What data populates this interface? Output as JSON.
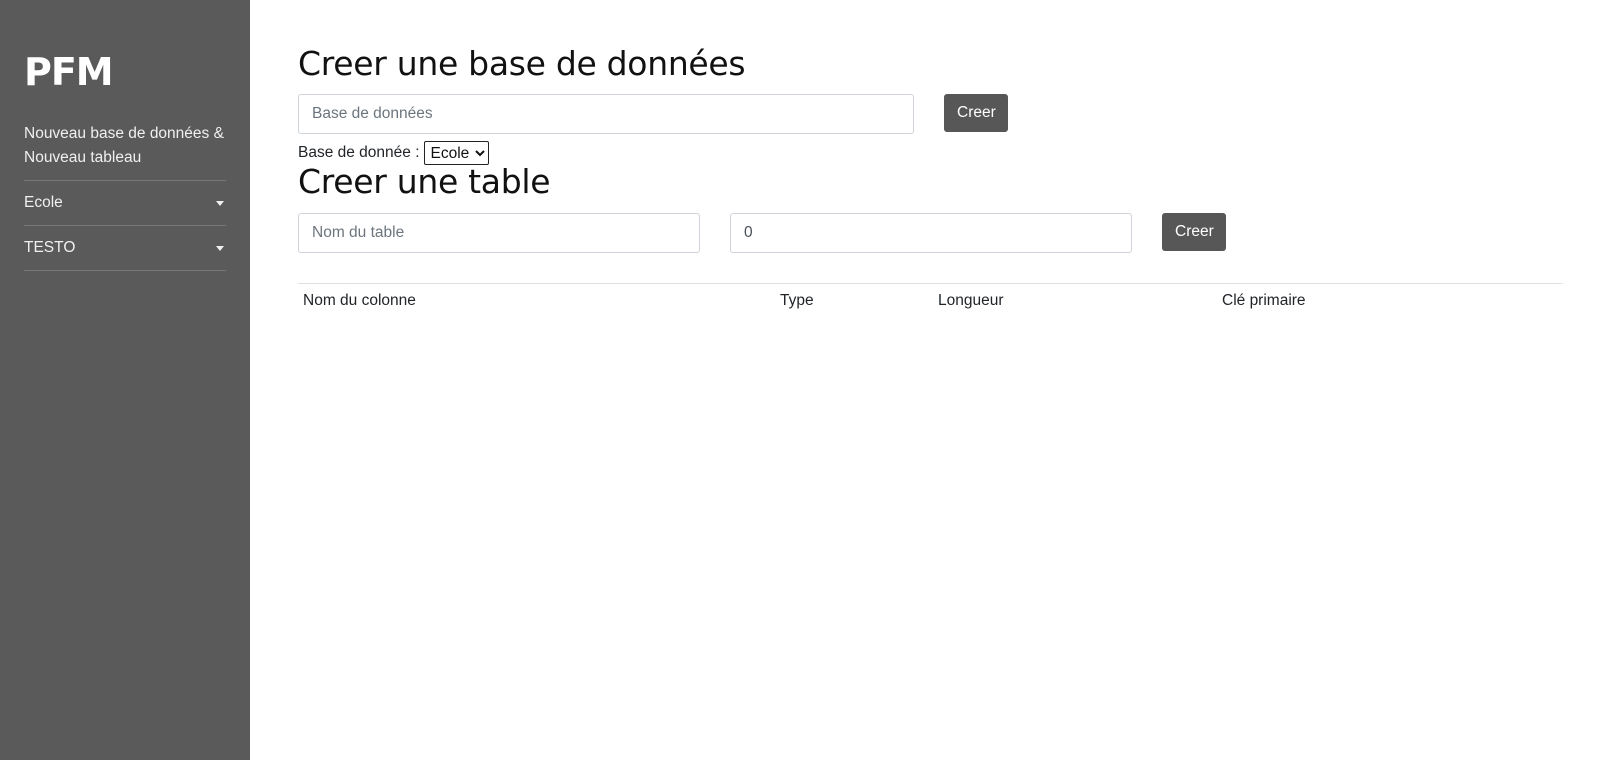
{
  "sidebar": {
    "brand": "PFM",
    "new_link": "Nouveau base de données & Nouveau tableau",
    "items": [
      {
        "label": "Ecole"
      },
      {
        "label": "TESTO"
      }
    ]
  },
  "create_db": {
    "title": "Creer une base de données",
    "input_placeholder": "Base de données",
    "button_label": "Creer"
  },
  "db_select": {
    "label": "Base de donnée :",
    "selected": "Ecole"
  },
  "create_table": {
    "title": "Creer une table",
    "name_placeholder": "Nom du table",
    "count_value": "0",
    "button_label": "Creer"
  },
  "columns_table": {
    "headers": [
      "Nom du colonne",
      "Type",
      "Longueur",
      "Clé primaire"
    ]
  },
  "colors": {
    "sidebar_bg": "#5a5a5a",
    "button_bg": "#575757"
  }
}
